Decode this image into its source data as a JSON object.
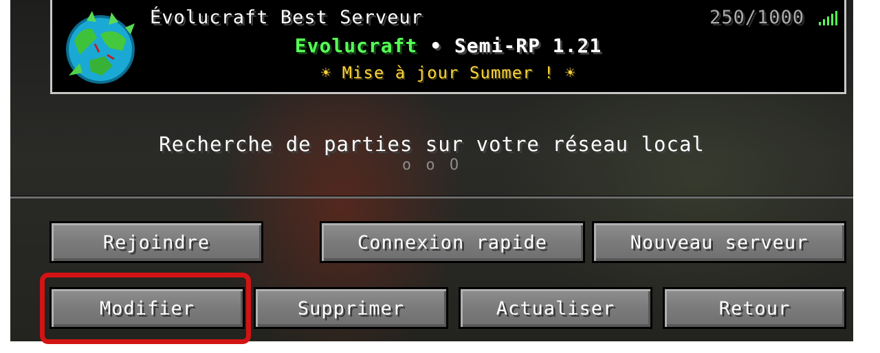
{
  "server": {
    "name": "Évolucraft Best Serveur",
    "player_count": "250/1000",
    "motd_brand": "Evolucraft",
    "motd_separator": " • ",
    "motd_tagline": "Semi-RP 1.21",
    "motd_update": "☀ Mise à jour Summer ! ☀",
    "icon": "globe-icon",
    "signal_icon": "signal-bars-icon",
    "signal_color": "#55ff55"
  },
  "lan": {
    "status": "Recherche de parties sur votre réseau local",
    "dots": "o o O"
  },
  "buttons": {
    "join": "Rejoindre",
    "direct_connect": "Connexion rapide",
    "add_server": "Nouveau serveur",
    "edit": "Modifier",
    "delete": "Supprimer",
    "refresh": "Actualiser",
    "back": "Retour"
  },
  "colors": {
    "highlight": "#d21414",
    "motd_green": "#55ff55",
    "motd_yellow": "#fcd23c"
  }
}
